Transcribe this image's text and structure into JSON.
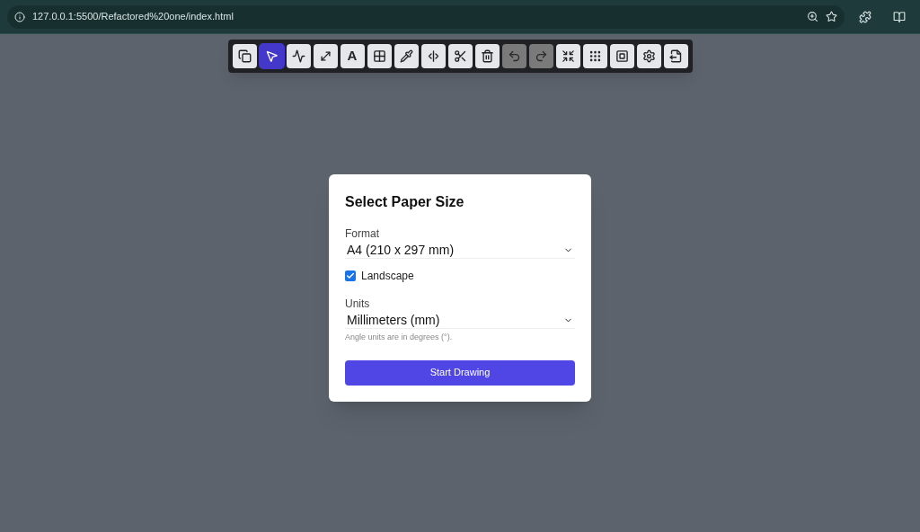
{
  "browser": {
    "url": "127.0.0.1:5500/Refactored%20one/index.html"
  },
  "toolbar": [
    {
      "kind": "copy",
      "selected": false,
      "disabled": false
    },
    {
      "kind": "pointer",
      "selected": true,
      "disabled": false
    },
    {
      "kind": "polyline",
      "selected": false,
      "disabled": false
    },
    {
      "kind": "dimension",
      "selected": false,
      "disabled": false
    },
    {
      "kind": "text",
      "label": "A",
      "selected": false,
      "disabled": false
    },
    {
      "kind": "grid",
      "selected": false,
      "disabled": false
    },
    {
      "kind": "pen",
      "selected": false,
      "disabled": false
    },
    {
      "kind": "split",
      "selected": false,
      "disabled": false
    },
    {
      "kind": "scissors",
      "selected": false,
      "disabled": false
    },
    {
      "kind": "trash",
      "selected": false,
      "disabled": false
    },
    {
      "kind": "undo",
      "selected": false,
      "disabled": true
    },
    {
      "kind": "redo",
      "selected": false,
      "disabled": true
    },
    {
      "kind": "shrink",
      "selected": false,
      "disabled": false
    },
    {
      "kind": "dots",
      "selected": false,
      "disabled": false
    },
    {
      "kind": "frame",
      "selected": false,
      "disabled": false
    },
    {
      "kind": "settings",
      "selected": false,
      "disabled": false
    },
    {
      "kind": "export",
      "selected": false,
      "disabled": false
    }
  ],
  "dialog": {
    "title": "Select Paper Size",
    "format": {
      "label": "Format",
      "value": "A4 (210 x 297 mm)"
    },
    "landscape": {
      "label": "Landscape",
      "checked": true
    },
    "units": {
      "label": "Units",
      "value": "Millimeters (mm)"
    },
    "hint": "Angle units are in degrees (°).",
    "button": "Start Drawing"
  }
}
